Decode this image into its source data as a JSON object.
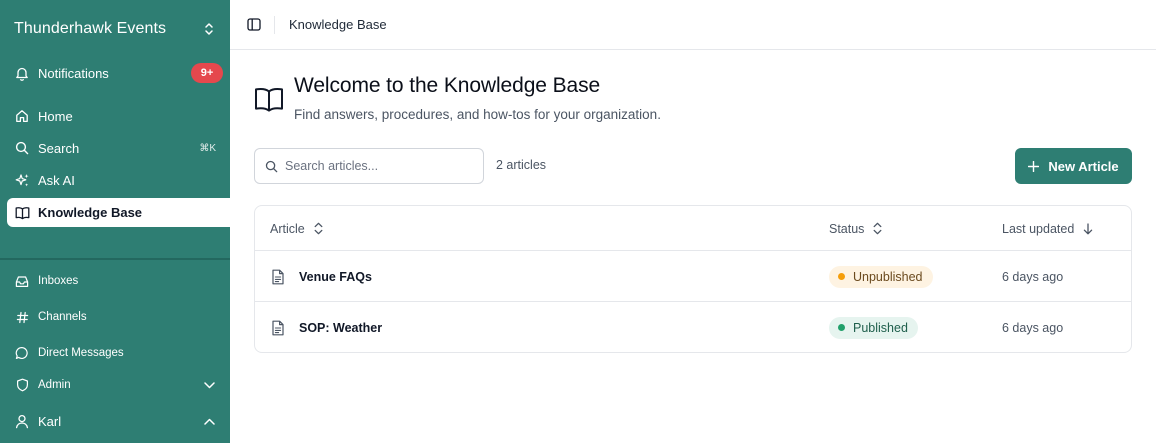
{
  "sidebar": {
    "workspace_name": "Thunderhawk Events",
    "notifications": {
      "label": "Notifications",
      "badge": "9+"
    },
    "items": [
      {
        "label": "Home",
        "icon": "home-icon"
      },
      {
        "label": "Search",
        "icon": "search-icon",
        "shortcut": "⌘K"
      },
      {
        "label": "Ask AI",
        "icon": "sparkles-icon"
      },
      {
        "label": "Knowledge Base",
        "icon": "book-icon",
        "active": true
      }
    ],
    "secondary": [
      {
        "label": "Inboxes",
        "icon": "inbox-icon"
      },
      {
        "label": "Channels",
        "icon": "hash-icon"
      },
      {
        "label": "Direct Messages",
        "icon": "message-icon"
      },
      {
        "label": "Admin",
        "icon": "shield-icon",
        "chevron": "down"
      }
    ],
    "user": {
      "label": "Karl",
      "icon": "user-icon",
      "chevron": "up"
    }
  },
  "topbar": {
    "breadcrumb": "Knowledge Base"
  },
  "header": {
    "title": "Welcome to the Knowledge Base",
    "subtitle": "Find answers, procedures, and how-tos for your organization."
  },
  "toolbar": {
    "search_placeholder": "Search articles...",
    "count": "2 articles",
    "new_button": "New Article"
  },
  "table": {
    "columns": [
      "Article",
      "Status",
      "Last updated"
    ],
    "rows": [
      {
        "title": "Venue FAQs",
        "status": "Unpublished",
        "updated": "6 days ago"
      },
      {
        "title": "SOP: Weather",
        "status": "Published",
        "updated": "6 days ago"
      }
    ]
  },
  "colors": {
    "accent": "#2e7e73",
    "badge": "#e5484d",
    "unpublished_dot": "#f59e0b",
    "published_dot": "#22a06b"
  }
}
